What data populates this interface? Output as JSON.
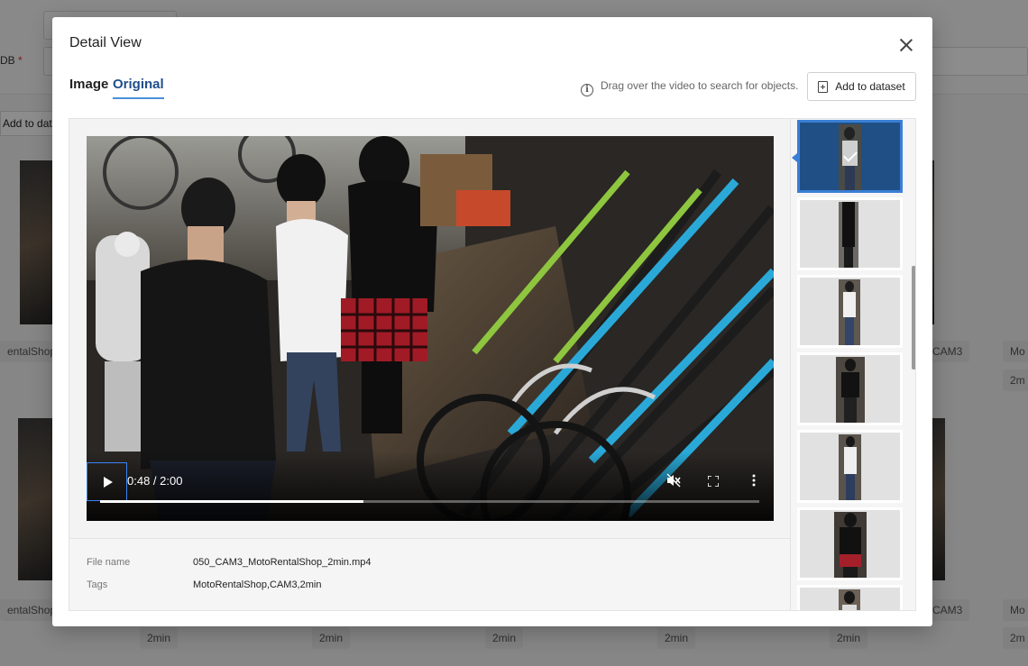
{
  "background": {
    "field_label": "DB",
    "required_mark": "*",
    "button_label": "Add to dataset",
    "tags_row1": [
      "entalShop",
      "CAM3",
      "Mo",
      "2m"
    ],
    "tags_row2": [
      "entalShop",
      "CAM3",
      "Mo",
      "2m"
    ],
    "bottom_tags": [
      "2min",
      "2min",
      "2min",
      "2min",
      "2min"
    ]
  },
  "modal": {
    "title": "Detail View",
    "tabs": [
      {
        "label": "Image",
        "active": false
      },
      {
        "label": "Original",
        "active": true
      }
    ],
    "hint": "Drag over the video to search for objects.",
    "info_icon_glyph": "i",
    "add_button_label": "Add to dataset",
    "close_icon": "close-icon"
  },
  "video": {
    "time": "0:48 / 2:00",
    "progress": 0.4,
    "icons": [
      "play-icon",
      "mute-icon",
      "fullscreen-icon",
      "more-icon"
    ]
  },
  "details": {
    "file_name_label": "File name",
    "file_name": "050_CAM3_MotoRentalShop_2min.mp4",
    "tags_label": "Tags",
    "tags": "MotoRentalShop,CAM3,2min"
  },
  "thumbnails": {
    "count": 7,
    "selected_index": 0
  },
  "colors": {
    "accent": "#4a90d9",
    "selected_thumb": "#1f4f85",
    "tab_active_text": "#1f4f8a"
  }
}
